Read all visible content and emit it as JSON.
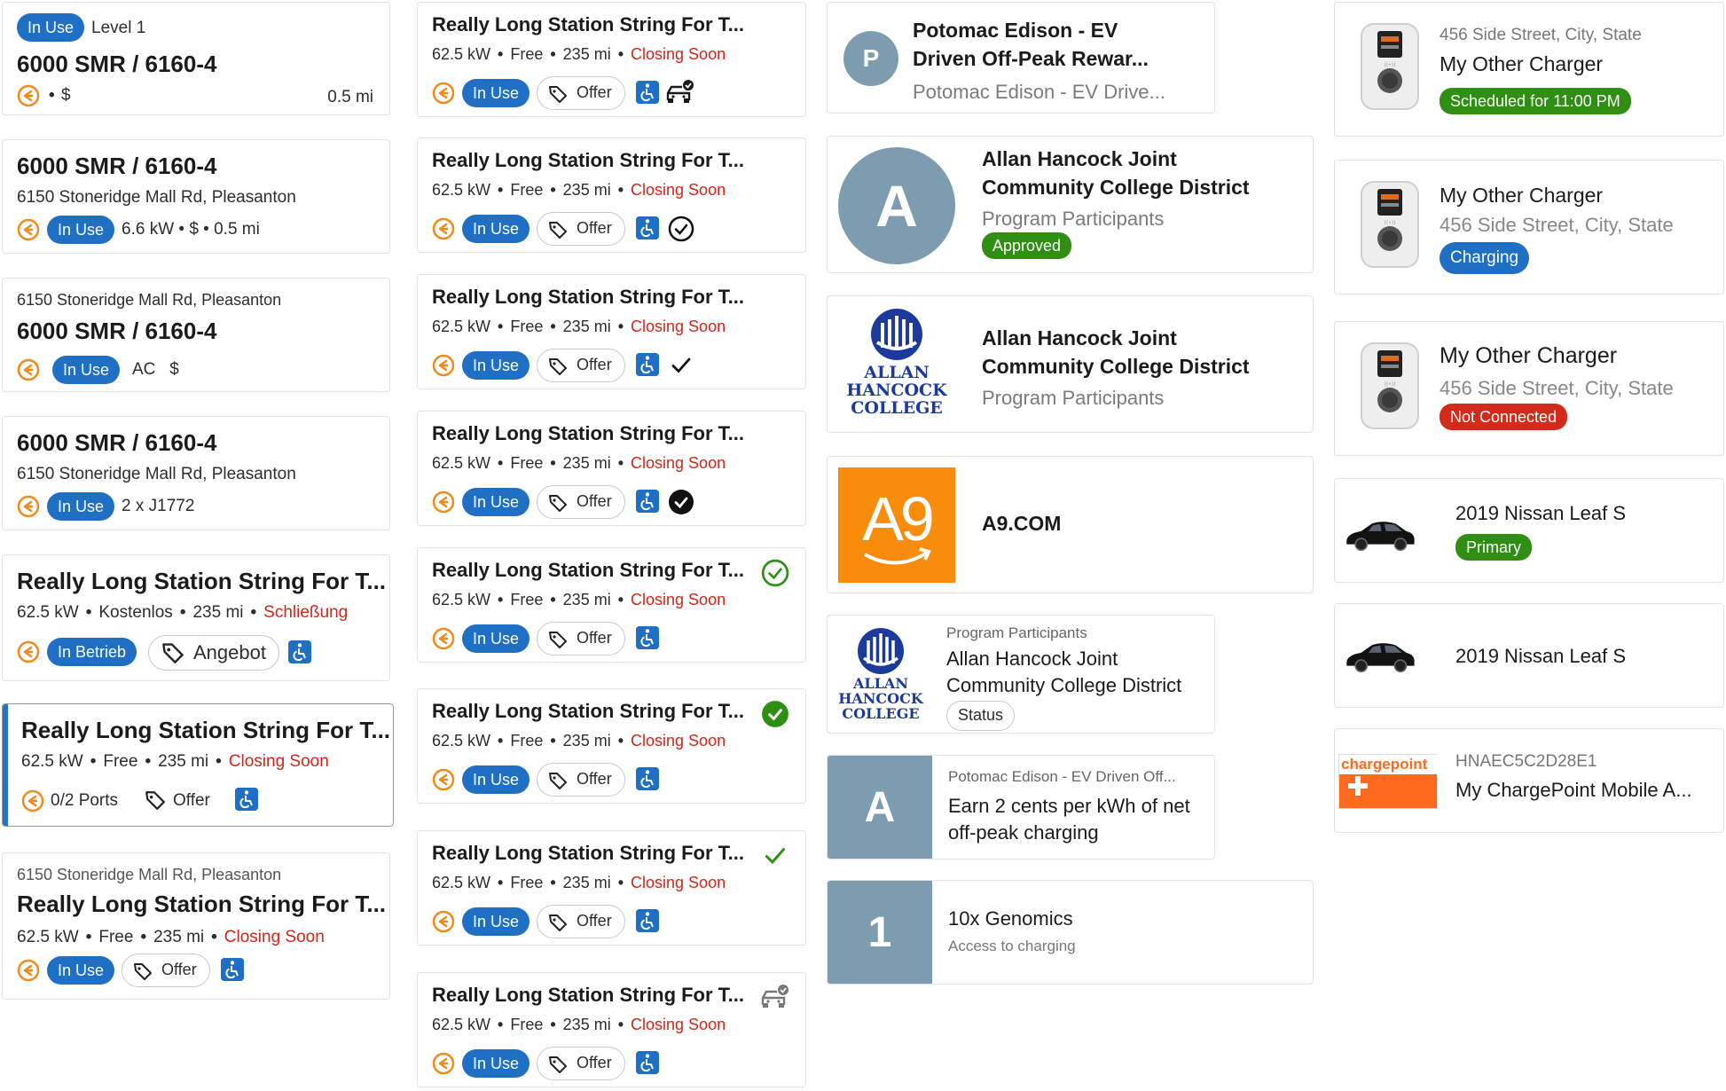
{
  "col1": {
    "c1": {
      "badge": "In Use",
      "level": "Level 1",
      "title": "6000 SMR / 6160-4",
      "price": "$",
      "distance": "0.5 mi"
    },
    "c2": {
      "title": "6000 SMR / 6160-4",
      "address": "6150 Stoneridge Mall Rd, Pleasanton",
      "badge": "In Use",
      "meta": "6.6 kW • $ • 0.5 mi"
    },
    "c3": {
      "address": "6150 Stoneridge Mall Rd, Pleasanton",
      "title": "6000 SMR / 6160-4",
      "badge": "In Use",
      "meta": "AC   $"
    },
    "c4": {
      "title": "6000 SMR / 6160-4",
      "address": "6150 Stoneridge Mall Rd, Pleasanton",
      "badge": "In Use",
      "meta": "2 x J1772"
    },
    "c5": {
      "title": "Really Long Station String For T...",
      "power": "62.5 kW",
      "price": "Kostenlos",
      "dist": "235 mi",
      "status": "Schließung",
      "badge": "In Betrieb",
      "offer": "Angebot"
    },
    "c6": {
      "title": "Really Long Station String For T...",
      "power": "62.5 kW",
      "price": "Free",
      "dist": "235 mi",
      "status": "Closing Soon",
      "ports": "0/2 Ports",
      "offer": "Offer"
    },
    "c7": {
      "address": "6150 Stoneridge Mall Rd, Pleasanton",
      "title": "Really Long Station String For T...",
      "power": "62.5 kW",
      "price": "Free",
      "dist": "235 mi",
      "status": "Closing Soon",
      "badge": "In Use",
      "offer": "Offer"
    }
  },
  "col2": {
    "cards": [
      {
        "title": "Really Long Station String For T...",
        "power": "62.5 kW",
        "price": "Free",
        "dist": "235 mi",
        "status": "Closing Soon",
        "badge": "In Use",
        "offer": "Offer"
      },
      {
        "title": "Really Long Station String For T...",
        "power": "62.5 kW",
        "price": "Free",
        "dist": "235 mi",
        "status": "Closing Soon",
        "badge": "In Use",
        "offer": "Offer"
      },
      {
        "title": "Really Long Station String For T...",
        "power": "62.5 kW",
        "price": "Free",
        "dist": "235 mi",
        "status": "Closing Soon",
        "badge": "In Use",
        "offer": "Offer"
      },
      {
        "title": "Really Long Station String For T...",
        "power": "62.5 kW",
        "price": "Free",
        "dist": "235 mi",
        "status": "Closing Soon",
        "badge": "In Use",
        "offer": "Offer"
      },
      {
        "title": "Really Long Station String For T...",
        "power": "62.5 kW",
        "price": "Free",
        "dist": "235 mi",
        "status": "Closing Soon",
        "badge": "In Use",
        "offer": "Offer"
      },
      {
        "title": "Really Long Station String For T...",
        "power": "62.5 kW",
        "price": "Free",
        "dist": "235 mi",
        "status": "Closing Soon",
        "badge": "In Use",
        "offer": "Offer"
      },
      {
        "title": "Really Long Station String For T...",
        "power": "62.5 kW",
        "price": "Free",
        "dist": "235 mi",
        "status": "Closing Soon",
        "badge": "In Use",
        "offer": "Offer"
      },
      {
        "title": "Really Long Station String For T...",
        "power": "62.5 kW",
        "price": "Free",
        "dist": "235 mi",
        "status": "Closing Soon",
        "badge": "In Use",
        "offer": "Offer"
      }
    ]
  },
  "col3": {
    "potomac": {
      "initial": "P",
      "title1": "Potomac Edison - EV",
      "title2": "Driven Off-Peak Rewar...",
      "subtitle": "Potomac Edison - EV Drive..."
    },
    "hancock1": {
      "initial": "A",
      "title1": "Allan Hancock Joint",
      "title2": "Community College District",
      "subtitle": "Program Participants",
      "status": "Approved"
    },
    "hancock2": {
      "logo_line1": "ALLAN",
      "logo_line2": "HANCOCK",
      "logo_line3": "COLLEGE",
      "title1": "Allan Hancock Joint",
      "title2": "Community College District",
      "subtitle": "Program Participants"
    },
    "a9": {
      "logo": "A9",
      "title": "A9.COM"
    },
    "hancock3": {
      "logo_line1": "ALLAN",
      "logo_line2": "HANCOCK",
      "logo_line3": "COLLEGE",
      "overline": "Program Participants",
      "title1": "Allan Hancock Joint",
      "title2": "Community College District",
      "status": "Status"
    },
    "earn": {
      "initial": "A",
      "overline": "Potomac Edison - EV Driven Off...",
      "title1": "Earn 2 cents per kWh of net",
      "title2": "off-peak charging"
    },
    "genomics": {
      "initial": "1",
      "title": "10x Genomics",
      "subtitle": "Access to charging"
    }
  },
  "col4": {
    "ch1": {
      "address": "456 Side Street, City, State",
      "name": "My Other Charger",
      "status": "Scheduled for 11:00 PM"
    },
    "ch2": {
      "name": "My Other Charger",
      "address": "456 Side Street, City, State",
      "status": "Charging"
    },
    "ch3": {
      "name": "My Other Charger",
      "address": "456 Side Street, City, State",
      "status": "Not Connected"
    },
    "car1": {
      "name": "2019 Nissan Leaf S",
      "status": "Primary"
    },
    "car2": {
      "name": "2019 Nissan Leaf S"
    },
    "card": {
      "logo": "chargepoint",
      "serial": "HNAEC5C2D28E1",
      "name": "My ChargePoint Mobile A..."
    }
  },
  "colors": {
    "blue": "#1f6fc5",
    "green": "#2e8f13",
    "red": "#d32a19",
    "avatar": "#7e9cb0",
    "orange": "#ff8f00"
  }
}
